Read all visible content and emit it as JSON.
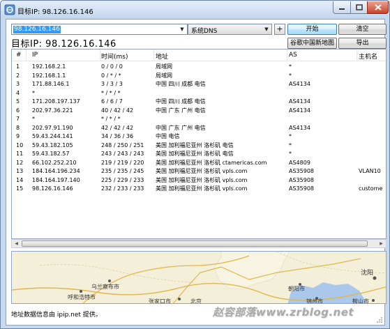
{
  "window": {
    "title": "目标IP: 98.126.16.146"
  },
  "controls": {
    "target_value": "98.126.16.146",
    "dns_selected": "系统DNS",
    "add_label": "+",
    "start_label": "开始",
    "clear_label": "清空",
    "map_label": "谷歌中国新地图",
    "export_label": "导出"
  },
  "target_heading": "目标IP:  98.126.16.146",
  "table": {
    "headers": {
      "num": "#",
      "ip": "IP",
      "time": "时间(ms)",
      "location": "地址",
      "as": "AS",
      "host": "主机名"
    },
    "rows": [
      {
        "n": "1",
        "ip": "192.168.2.1",
        "time": "0 / 0 / 0",
        "loc": "局域网",
        "as": "*",
        "host": ""
      },
      {
        "n": "2",
        "ip": "192.168.1.1",
        "time": "0 / * / *",
        "loc": "局域网",
        "as": "*",
        "host": ""
      },
      {
        "n": "3",
        "ip": "171.88.146.1",
        "time": "3 / 3 / 3",
        "loc": "中国 四川 成都 电信",
        "as": "AS4134",
        "host": ""
      },
      {
        "n": "4",
        "ip": "*",
        "time": "* / * / *",
        "loc": "",
        "as": "",
        "host": ""
      },
      {
        "n": "5",
        "ip": "171.208.197.137",
        "time": "6 / 6 / 7",
        "loc": "中国 四川 成都 电信",
        "as": "AS4134",
        "host": ""
      },
      {
        "n": "6",
        "ip": "202.97.36.221",
        "time": "40 / 42 / 42",
        "loc": "中国 广东 广州 电信",
        "as": "AS4134",
        "host": ""
      },
      {
        "n": "7",
        "ip": "*",
        "time": "* / * / *",
        "loc": "",
        "as": "",
        "host": ""
      },
      {
        "n": "8",
        "ip": "202.97.91.190",
        "time": "42 / 42 / 42",
        "loc": "中国 广东 广州 电信",
        "as": "AS4134",
        "host": ""
      },
      {
        "n": "9",
        "ip": "59.43.244.141",
        "time": "34 / 36 / 36",
        "loc": "中国 电信",
        "as": "*",
        "host": ""
      },
      {
        "n": "10",
        "ip": "59.43.182.105",
        "time": "248 / 250 / 251",
        "loc": "美国 加利福尼亚州 洛杉矶 电信",
        "as": "*",
        "host": ""
      },
      {
        "n": "11",
        "ip": "59.43.182.57",
        "time": "243 / 243 / 243",
        "loc": "美国 加利福尼亚州 洛杉矶 电信",
        "as": "*",
        "host": ""
      },
      {
        "n": "12",
        "ip": "66.102.252.210",
        "time": "219 / 219 / 220",
        "loc": "美国 加利福尼亚州 洛杉矶 ctamericas.com",
        "as": "AS4809",
        "host": ""
      },
      {
        "n": "13",
        "ip": "184.164.196.234",
        "time": "235 / 235 / 245",
        "loc": "美国 加利福尼亚州 洛杉矶 vpls.com",
        "as": "AS35908",
        "host": "VLAN10"
      },
      {
        "n": "14",
        "ip": "184.164.197.140",
        "time": "225 / 229 / 233",
        "loc": "美国 加利福尼亚州 洛杉矶 vpls.com",
        "as": "AS35908",
        "host": ""
      },
      {
        "n": "15",
        "ip": "98.126.16.146",
        "time": "232 / 233 / 233",
        "loc": "美国 加利福尼亚州 洛杉矶 vpls.com",
        "as": "AS35908",
        "host": "custome"
      }
    ]
  },
  "map": {
    "cities": [
      "乌兰察布市",
      "呼和浩特市",
      "张家口市",
      "北京",
      "朝阳市",
      "锦州市",
      "鞍山市",
      "沈阳"
    ]
  },
  "status": {
    "text": "地址数据信息由 ipip.net 提供。",
    "watermark": "赵容部落www.zrblog.net"
  },
  "colors": {
    "selection": "#3399ff",
    "frame": "#c7d9ee",
    "map_land": "#f3efd9",
    "map_sea": "#a9c8ec"
  },
  "icons": [
    "app-icon",
    "minimize-icon",
    "maximize-icon",
    "close-icon",
    "chevron-down-icon",
    "scroll-left-icon",
    "scroll-right-icon",
    "resize-grip-icon"
  ]
}
